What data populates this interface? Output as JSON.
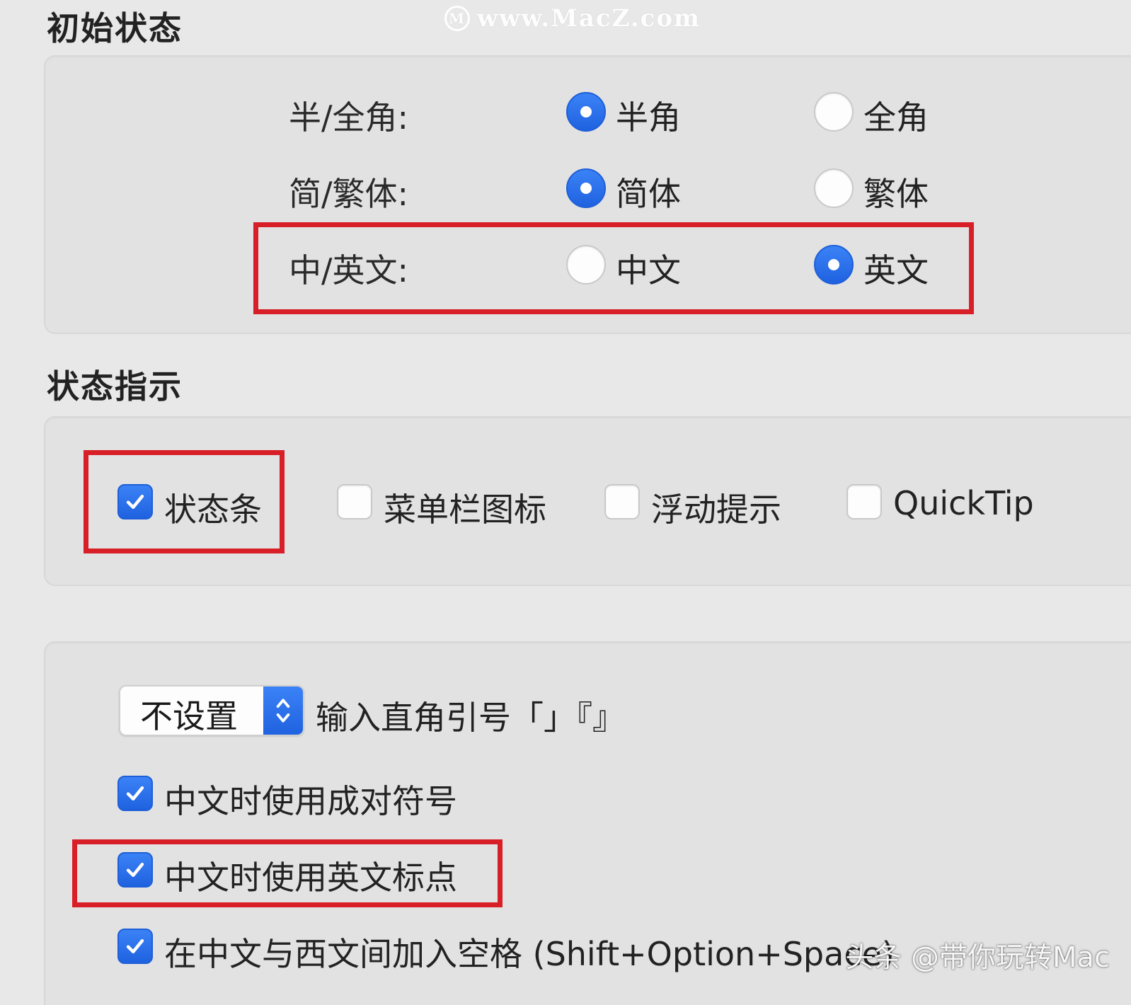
{
  "watermark_top": {
    "logo": "M",
    "text": "www.MacZ.com"
  },
  "initial_state": {
    "title": "初始状态",
    "rows": [
      {
        "label": "半/全角:",
        "options": [
          "半角",
          "全角"
        ],
        "selected": 0
      },
      {
        "label": "简/繁体:",
        "options": [
          "简体",
          "繁体"
        ],
        "selected": 0
      },
      {
        "label": "中/英文:",
        "options": [
          "中文",
          "英文"
        ],
        "selected": 1
      }
    ]
  },
  "status_indicator": {
    "title": "状态指示",
    "items": [
      {
        "label": "状态条",
        "checked": true
      },
      {
        "label": "菜单栏图标",
        "checked": false
      },
      {
        "label": "浮动提示",
        "checked": false
      },
      {
        "label": "QuickTip",
        "checked": false
      }
    ]
  },
  "punctuation": {
    "quote_popup": {
      "value": "不设置",
      "label": "输入直角引号「」『』"
    },
    "options": [
      {
        "label": "中文时使用成对符号",
        "checked": true
      },
      {
        "label": "中文时使用英文标点",
        "checked": true
      },
      {
        "label": "在中文与西文间加入空格 (Shift+Option+Space)",
        "checked": true
      }
    ]
  },
  "bottom_watermark": "头条 @带你玩转Mac",
  "colors": {
    "accent": "#2169e6",
    "highlight": "#d81e27",
    "panel": "#e2e2e2",
    "background": "#e8e8e8"
  }
}
